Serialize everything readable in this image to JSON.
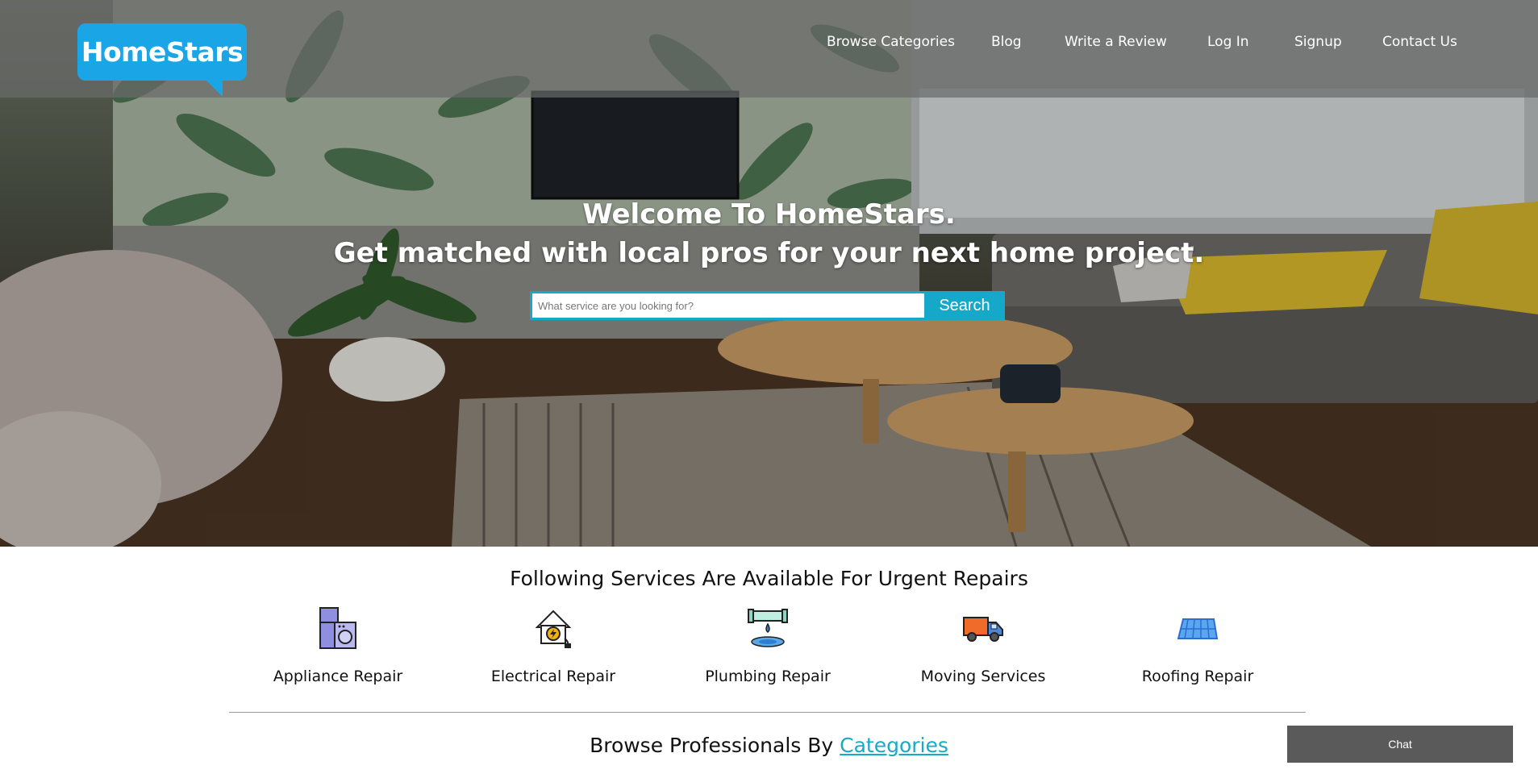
{
  "brand": {
    "name": "HomeStars",
    "color": "#1aa6e6"
  },
  "nav": {
    "items": [
      {
        "label": "Browse Categories"
      },
      {
        "label": "Blog"
      },
      {
        "label": "Write a Review"
      },
      {
        "label": "Log In"
      },
      {
        "label": "Signup"
      },
      {
        "label": "Contact Us"
      }
    ]
  },
  "hero": {
    "line1": "Welcome To HomeStars.",
    "line2": "Get matched with local pros for your next home project.",
    "search": {
      "placeholder": "What service are you looking for?",
      "value": "",
      "button_label": "Search"
    }
  },
  "services": {
    "title": "Following Services Are Available For Urgent Repairs",
    "items": [
      {
        "label": "Appliance Repair",
        "icon": "appliance-icon"
      },
      {
        "label": "Electrical Repair",
        "icon": "electrical-icon"
      },
      {
        "label": "Plumbing Repair",
        "icon": "plumbing-icon"
      },
      {
        "label": "Moving Services",
        "icon": "moving-truck-icon"
      },
      {
        "label": "Roofing Repair",
        "icon": "roofing-icon"
      }
    ]
  },
  "browse": {
    "prefix": "Browse Professionals By ",
    "link": "Categories"
  },
  "chat": {
    "label": "Chat"
  },
  "colors": {
    "accent": "#16a8c9",
    "nav_bg": "#696969",
    "chat_bg": "#5a5a5a"
  }
}
